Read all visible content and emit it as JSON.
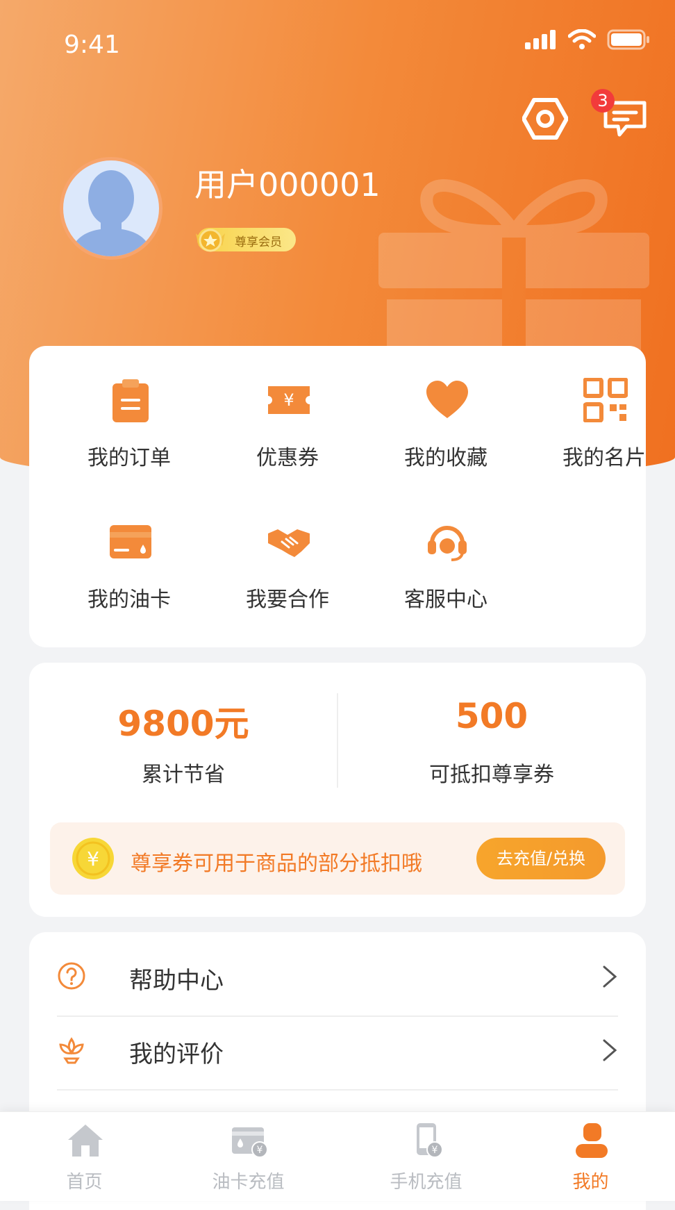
{
  "status_bar": {
    "time": "9:41"
  },
  "header": {
    "message_count": "3"
  },
  "user": {
    "name": "用户000001",
    "member_level": "尊享会员"
  },
  "grid": [
    {
      "label": "我的订单",
      "icon": "clipboard-icon"
    },
    {
      "label": "优惠券",
      "icon": "coupon-icon"
    },
    {
      "label": "我的收藏",
      "icon": "heart-icon"
    },
    {
      "label": "我的名片",
      "icon": "qrcode-icon"
    },
    {
      "label": "我的油卡",
      "icon": "card-icon"
    },
    {
      "label": "我要合作",
      "icon": "handshake-icon"
    },
    {
      "label": "客服中心",
      "icon": "headset-icon"
    }
  ],
  "stats": {
    "saved_value": "9800元",
    "saved_label": "累计节省",
    "coupon_value": "500",
    "coupon_label": "可抵扣尊享券"
  },
  "coupon_tip": {
    "text": "尊享券可用于商品的部分抵扣哦",
    "button": "去充值/兑换",
    "icon": "yen-coin-icon"
  },
  "list": [
    {
      "label": "帮助中心",
      "icon": "question-circle-icon"
    },
    {
      "label": "我的评价",
      "icon": "flower-icon"
    }
  ],
  "tabbar": [
    {
      "label": "首页",
      "icon": "home-icon"
    },
    {
      "label": "油卡充值",
      "icon": "fuel-card-icon"
    },
    {
      "label": "手机充值",
      "icon": "phone-icon"
    },
    {
      "label": "我的",
      "icon": "user-icon",
      "active": true
    }
  ],
  "colors": {
    "accent": "#f27a26",
    "badge": "#f23b3b",
    "inactive": "#b9bcc1"
  }
}
